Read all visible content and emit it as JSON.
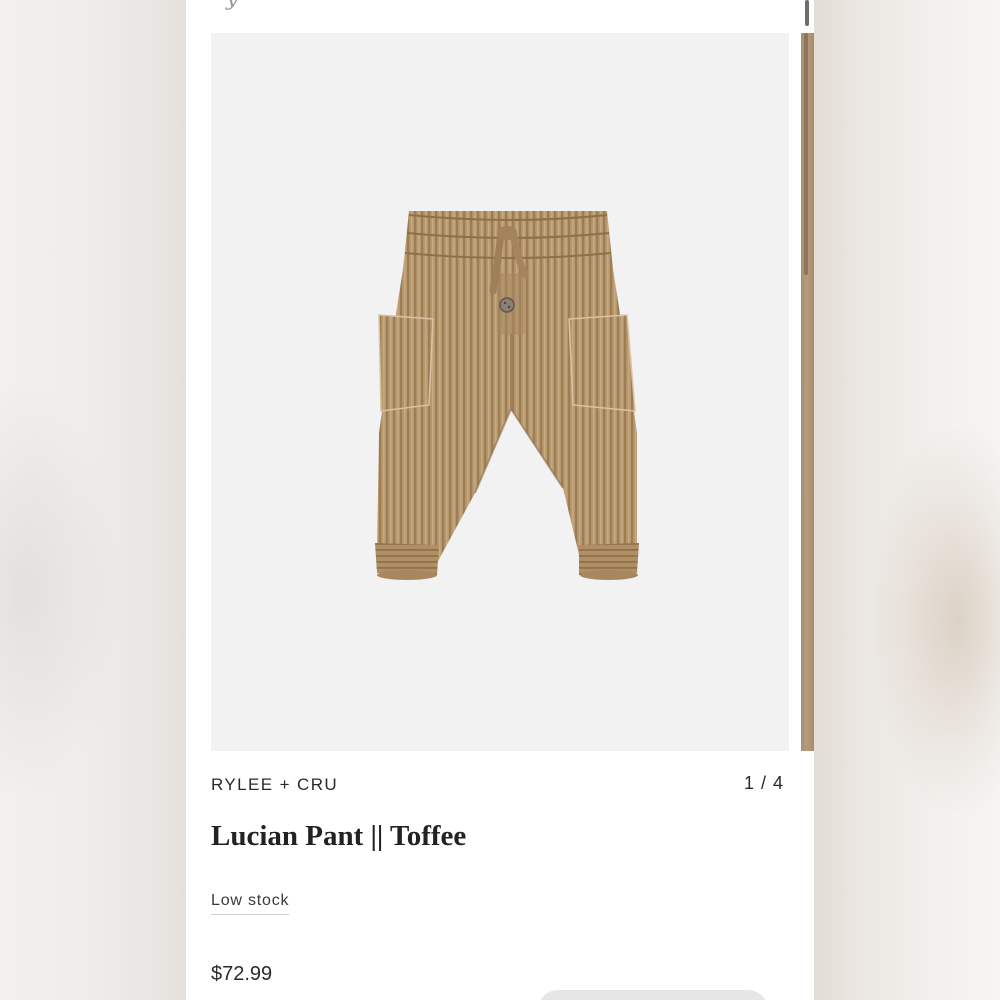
{
  "product": {
    "brand": "RYLEE + CRU",
    "title": "Lucian Pant || Toffee",
    "stock_status": "Low stock",
    "price": "$72.99",
    "image_counter": "1 / 4",
    "image_index": 1,
    "image_total": 4,
    "image_subject": "corduroy-pants-toffee"
  },
  "colors": {
    "accent": "#b59c7c",
    "text": "#2a2a2a",
    "image_background": "#f2f2f3"
  }
}
